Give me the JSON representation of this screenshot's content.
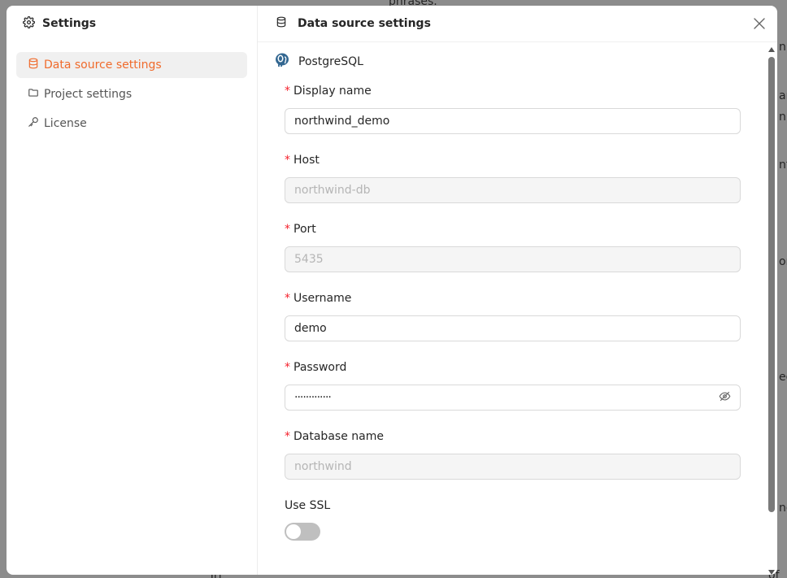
{
  "background": {
    "fragments": [
      "phrases.",
      "n t",
      "ar",
      "n].",
      "nt",
      "orr",
      "ec",
      "ne",
      "\"Tri",
      "of"
    ]
  },
  "sidebar": {
    "title": "Settings",
    "items": [
      {
        "label": "Data source settings",
        "icon": "database-icon",
        "active": true
      },
      {
        "label": "Project settings",
        "icon": "folder-icon",
        "active": false
      },
      {
        "label": "License",
        "icon": "key-icon",
        "active": false
      }
    ]
  },
  "main": {
    "title": "Data source settings",
    "datasource_type": "PostgreSQL",
    "fields": {
      "display_name": {
        "label": "Display name",
        "value": "northwind_demo",
        "required": true
      },
      "host": {
        "label": "Host",
        "placeholder": "northwind-db",
        "required": true
      },
      "port": {
        "label": "Port",
        "placeholder": "5435",
        "required": true
      },
      "username": {
        "label": "Username",
        "value": "demo",
        "required": true
      },
      "password": {
        "label": "Password",
        "value": "·············",
        "required": true
      },
      "database_name": {
        "label": "Database name",
        "placeholder": "northwind",
        "required": true
      }
    },
    "ssl": {
      "label": "Use SSL",
      "enabled": false
    }
  },
  "colors": {
    "accent": "#f06b2c",
    "required": "#f5222d"
  }
}
